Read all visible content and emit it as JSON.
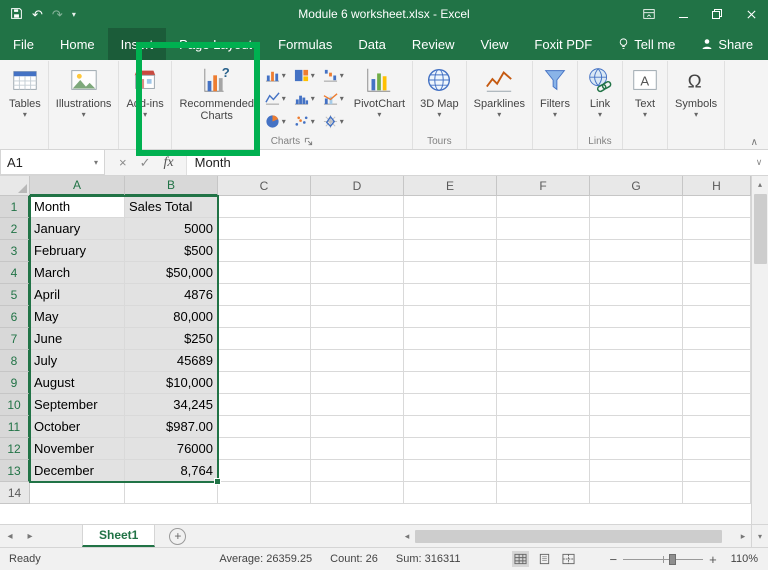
{
  "colors": {
    "excel_green": "#217346",
    "annotation_green": "#00b050",
    "selection_fill": "#e2e2e2",
    "chart_blue": "#4472c4",
    "chart_orange": "#ed7d31"
  },
  "titlebar": {
    "title": "Module 6 worksheet.xlsx -  Excel"
  },
  "tabs": {
    "file": "File",
    "home": "Home",
    "insert": "Insert",
    "page_layout": "Page Layout",
    "formulas": "Formulas",
    "data": "Data",
    "review": "Review",
    "view": "View",
    "foxit_pdf": "Foxit PDF",
    "tell_me": "Tell me",
    "share": "Share",
    "active": "Insert"
  },
  "ribbon": {
    "tables": "Tables",
    "illustrations": "Illustrations",
    "add_ins": "Add-ins",
    "recommended_charts": "Recommended Charts",
    "pivotchart": "PivotChart",
    "map_3d": "3D Map",
    "sparklines": "Sparklines",
    "filters": "Filters",
    "link": "Link",
    "text": "Text",
    "symbols": "Symbols",
    "charts_group_label": "Charts",
    "tours_group_label": "Tours",
    "links_group_label": "Links",
    "chart_type_icons": [
      "column-chart-icon",
      "hierarchy-chart-icon",
      "waterfall-chart-icon",
      "line-chart-icon",
      "statistic-chart-icon",
      "combo-chart-icon",
      "pie-chart-icon",
      "scatter-chart-icon",
      "radar-chart-icon"
    ]
  },
  "formula_bar": {
    "name_box": "A1",
    "fx_label": "fx",
    "value": "Month"
  },
  "sheet": {
    "columns": [
      "A",
      "B",
      "C",
      "D",
      "E",
      "F",
      "G",
      "H"
    ],
    "rows": [
      {
        "n": "1",
        "cells": {
          "A": "Month",
          "B": "Sales Total"
        }
      },
      {
        "n": "2",
        "cells": {
          "A": "January",
          "B": "5000"
        }
      },
      {
        "n": "3",
        "cells": {
          "A": "February",
          "B": "$500"
        }
      },
      {
        "n": "4",
        "cells": {
          "A": "March",
          "B": "$50,000"
        }
      },
      {
        "n": "5",
        "cells": {
          "A": "April",
          "B": "4876"
        }
      },
      {
        "n": "6",
        "cells": {
          "A": "May",
          "B": "80,000"
        }
      },
      {
        "n": "7",
        "cells": {
          "A": "June",
          "B": "$250"
        }
      },
      {
        "n": "8",
        "cells": {
          "A": "July",
          "B": "45689"
        }
      },
      {
        "n": "9",
        "cells": {
          "A": "August",
          "B": "$10,000"
        }
      },
      {
        "n": "10",
        "cells": {
          "A": "September",
          "B": "34,245"
        }
      },
      {
        "n": "11",
        "cells": {
          "A": "October",
          "B": "$987.00"
        }
      },
      {
        "n": "12",
        "cells": {
          "A": "November",
          "B": "76000"
        }
      },
      {
        "n": "13",
        "cells": {
          "A": "December",
          "B": "8,764"
        }
      },
      {
        "n": "14",
        "cells": {}
      }
    ],
    "selection": {
      "active_cell": "A1",
      "range": "A1:B13",
      "columns": [
        "A",
        "B"
      ],
      "last_row": 13
    }
  },
  "sheet_tabs": {
    "active": "Sheet1"
  },
  "status_bar": {
    "mode": "Ready",
    "average": "Average: 26359.25",
    "count": "Count: 26",
    "sum": "Sum: 316311",
    "zoom_level": "110%"
  }
}
